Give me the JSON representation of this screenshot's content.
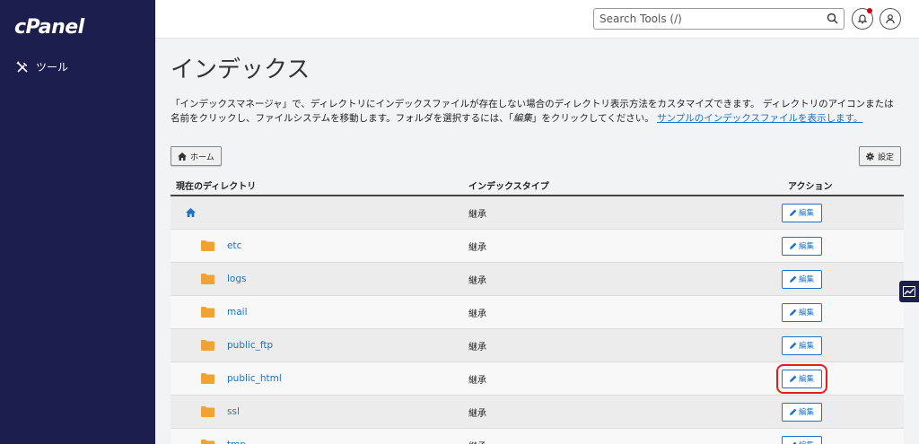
{
  "brand": {
    "logo": "cPanel"
  },
  "sidebar": {
    "items": [
      {
        "label": "ツール",
        "icon": "tools-icon"
      }
    ]
  },
  "topbar": {
    "search_placeholder": "Search Tools (/)"
  },
  "page": {
    "title": "インデックス",
    "description": "「インデックスマネージャ」で、ディレクトリにインデックスファイルが存在しない場合のディレクトリ表示方法をカスタマイズできます。 ディレクトリのアイコンまたは名前をクリックし、ファイルシステムを移動します。フォルダを選択するには、「",
    "description_em": "編集",
    "description_tail": "」をクリックしてください。",
    "sample_link": "サンプルのインデックスファイルを表示します。"
  },
  "toolbar": {
    "home_label": "ホーム",
    "settings_label": "設定"
  },
  "table": {
    "headers": [
      "現在のディレクトリ",
      "インデックスタイプ",
      "アクション"
    ],
    "edit_label": "編集",
    "rows": [
      {
        "name": "",
        "type": "継承"
      },
      {
        "name": "etc",
        "type": "継承"
      },
      {
        "name": "logs",
        "type": "継承"
      },
      {
        "name": "mail",
        "type": "継承"
      },
      {
        "name": "public_ftp",
        "type": "継承"
      },
      {
        "name": "public_html",
        "type": "継承"
      },
      {
        "name": "ssl",
        "type": "継承"
      },
      {
        "name": "tmp",
        "type": "継承"
      }
    ]
  },
  "colors": {
    "sidebar": "#1c1f4d",
    "link": "#1a73c9",
    "folder": "#f0a232",
    "highlight": "#e0201e"
  }
}
